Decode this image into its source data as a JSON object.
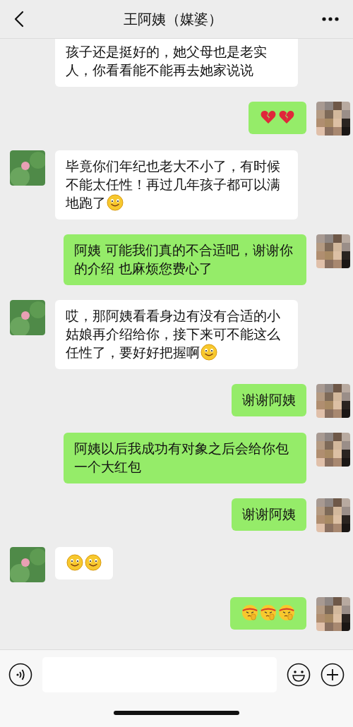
{
  "header": {
    "title": "王阿姨（媒婆）"
  },
  "messages": [
    {
      "sent": false,
      "avatar": false,
      "text": "孩子还是挺好的，她父母也是老实人，你看看能不能再去她家说说"
    },
    {
      "sent": true,
      "avatar": true,
      "emojis": [
        {
          "kind": "broken_heart"
        },
        {
          "kind": "broken_heart"
        }
      ]
    },
    {
      "sent": false,
      "avatar": true,
      "text": "毕竟你们年纪也老大不小了，有时候不能太任性！再过几年孩子都可以满地跑了",
      "emojis": [
        {
          "kind": "smile"
        }
      ]
    },
    {
      "sent": true,
      "avatar": true,
      "text": "阿姨 可能我们真的不合适吧，谢谢你的介绍 也麻烦您费心了"
    },
    {
      "sent": false,
      "avatar": true,
      "text": "哎，那阿姨看看身边有没有合适的小姑娘再介绍给你，接下来可不能这么任性了，要好好把握啊",
      "emojis": [
        {
          "kind": "smile"
        }
      ]
    },
    {
      "sent": true,
      "avatar": true,
      "text": "谢谢阿姨"
    },
    {
      "sent": true,
      "avatar": true,
      "text": "阿姨以后我成功有对象之后会给你包一个大红包"
    },
    {
      "sent": true,
      "avatar": true,
      "text": "谢谢阿姨"
    },
    {
      "sent": false,
      "avatar": true,
      "emojis": [
        {
          "kind": "smile"
        },
        {
          "kind": "smile"
        }
      ]
    },
    {
      "sent": true,
      "avatar": true,
      "emojis": [
        {
          "kind": "determined"
        },
        {
          "kind": "determined"
        },
        {
          "kind": "determined"
        }
      ]
    }
  ]
}
